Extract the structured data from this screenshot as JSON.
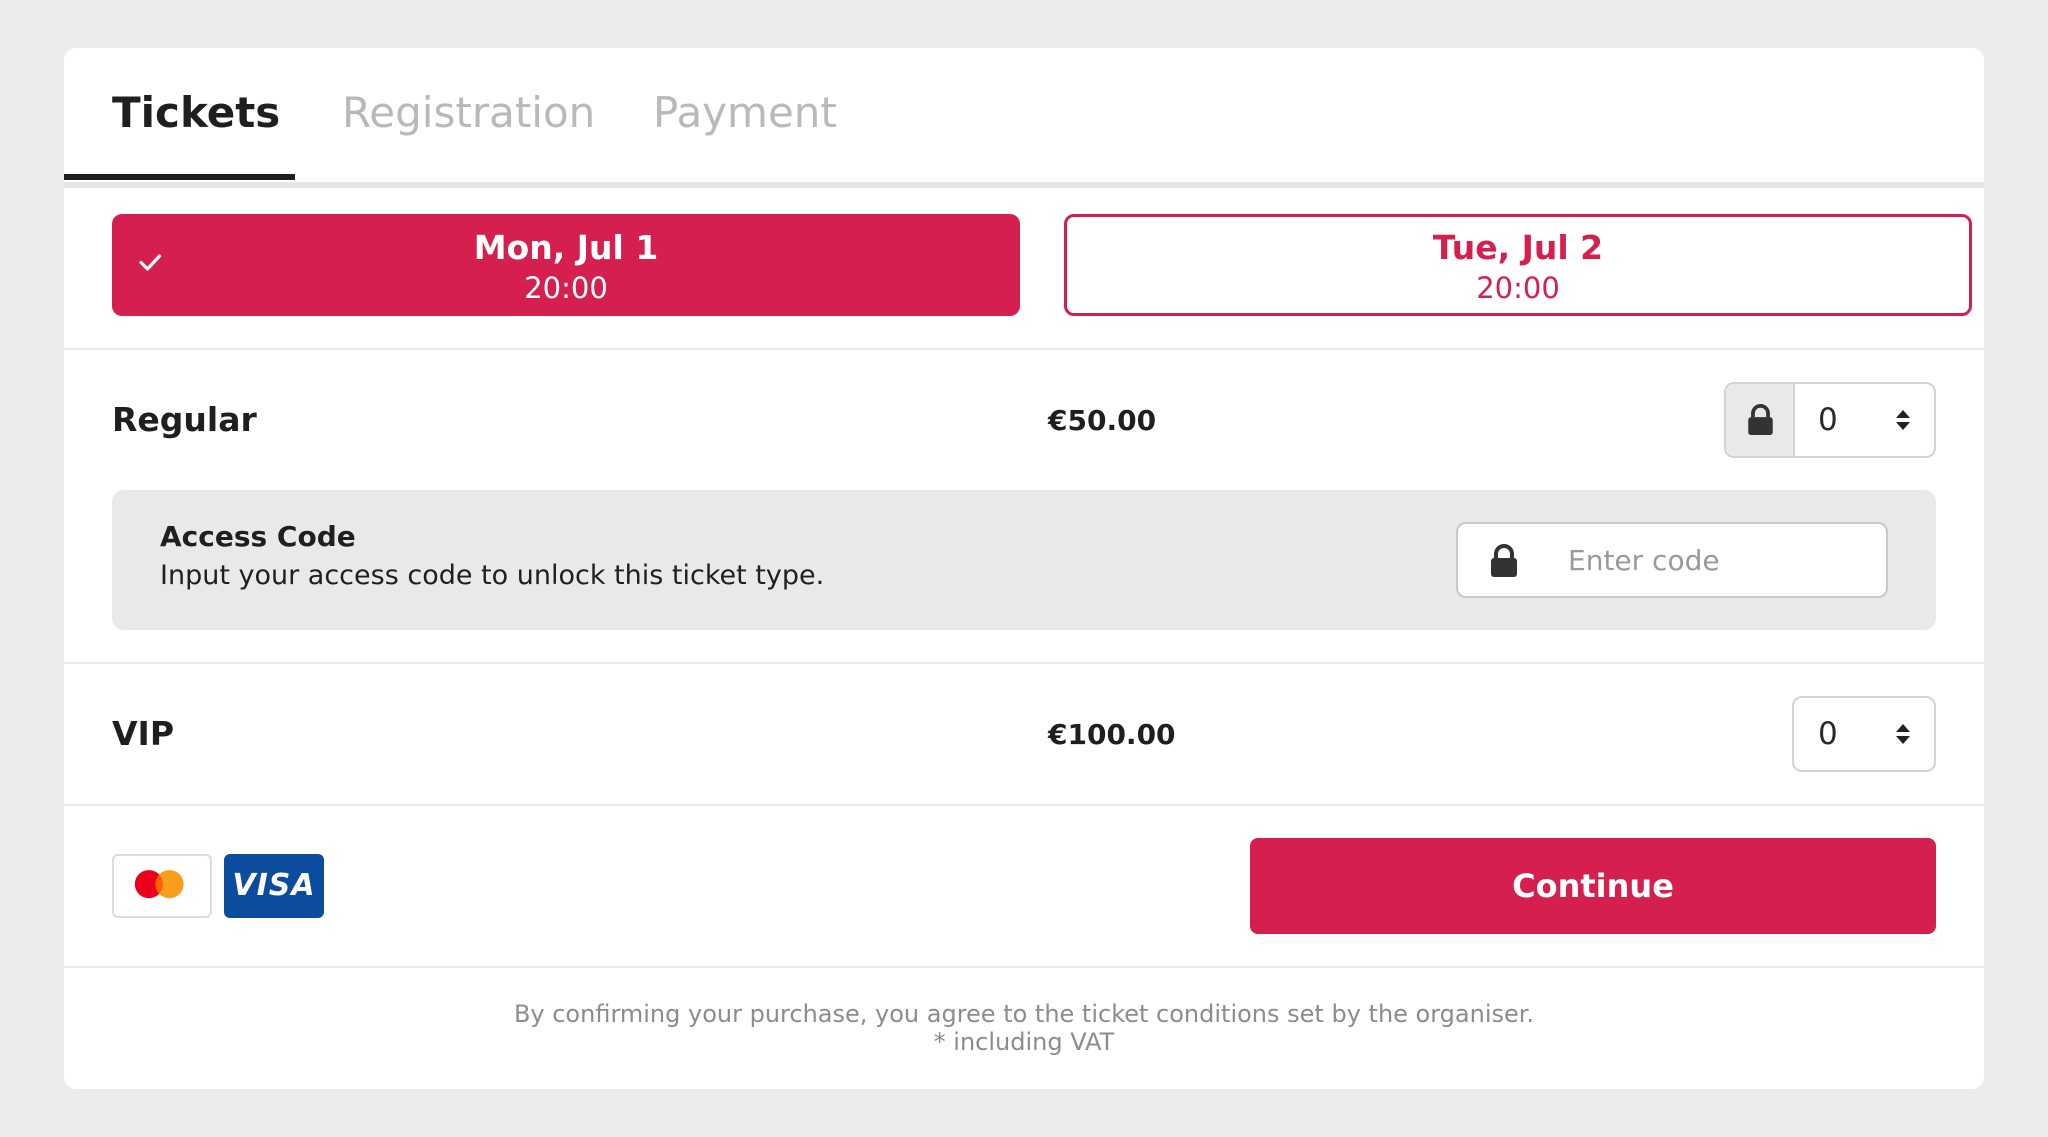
{
  "tabs": [
    {
      "label": "Tickets",
      "active": true
    },
    {
      "label": "Registration",
      "active": false
    },
    {
      "label": "Payment",
      "active": false
    }
  ],
  "dates": [
    {
      "day": "Mon, Jul 1",
      "time": "20:00",
      "selected": true
    },
    {
      "day": "Tue, Jul 2",
      "time": "20:00",
      "selected": false
    }
  ],
  "tickets": [
    {
      "name": "Regular",
      "price": "€50.00",
      "quantity": "0",
      "locked": true
    },
    {
      "name": "VIP",
      "price": "€100.00",
      "quantity": "0",
      "locked": false
    }
  ],
  "access_code": {
    "title": "Access Code",
    "description": "Input your access code to unlock this ticket type.",
    "placeholder": "Enter code",
    "value": ""
  },
  "payment_methods": [
    "mastercard-icon",
    "visa-icon"
  ],
  "visa_label": "VISA",
  "continue_label": "Continue",
  "footer": {
    "terms": "By confirming your purchase, you agree to the ticket conditions set by the organiser.",
    "vat_note": "* including VAT"
  },
  "colors": {
    "accent": "#d51f4f",
    "background": "#ebebeb",
    "card": "#ffffff",
    "panel": "#e9e9e9",
    "visa_blue": "#0b4d9c",
    "mastercard_red": "#eb001b",
    "mastercard_orange": "#f79e1b"
  }
}
